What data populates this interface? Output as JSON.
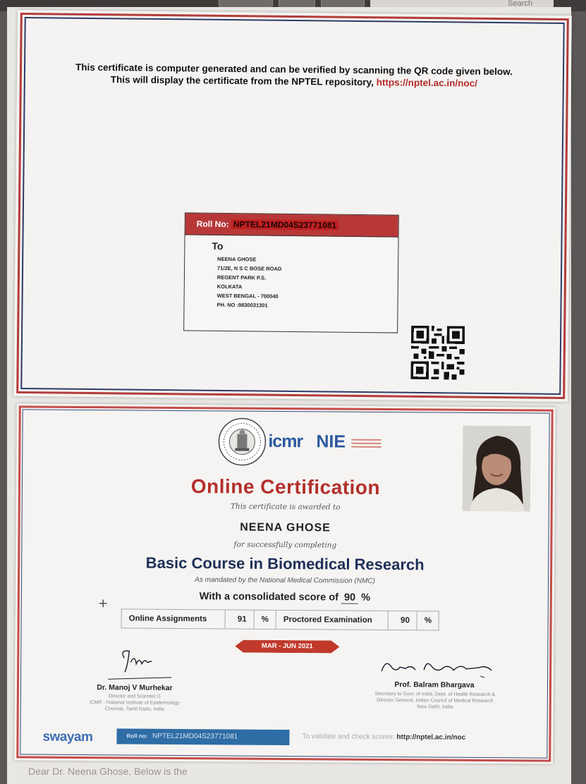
{
  "browser": {
    "search_label": "Search"
  },
  "sheet1": {
    "notice_line1": "This certificate is computer generated and can be verified by scanning the QR code given below.",
    "notice_line2": "This will display the certificate from the NPTEL repository,",
    "notice_url": "https://nptel.ac.in/noc/",
    "roll_label": "Roll No:",
    "roll_value": "NPTEL21MD04S23771081",
    "to_label": "To",
    "address": [
      "NEENA GHOSE",
      "71/2E, N S C BOSE ROAD",
      "REGENT PARK P.S.",
      "KOLKATA",
      "WEST BENGAL - 700040",
      "PH. NO :9830031301"
    ]
  },
  "sheet2": {
    "logo_icmr": "icmr",
    "logo_nie": "NIE",
    "title": "Online Certification",
    "awarded_to": "This certificate is awarded to",
    "recipient": "NEENA GHOSE",
    "completing": "for successfully completing",
    "course": "Basic Course in Biomedical Research",
    "mandate": "As mandated by the National Medical Commission (NMC)",
    "score_prefix": "With a consolidated score of",
    "score_value": "90",
    "score_suffix": "%",
    "table": {
      "online_label": "Online Assignments",
      "online_value": "91",
      "pct1": "%",
      "proctored_label": "Proctored Examination",
      "proctored_value": "90",
      "pct2": "%"
    },
    "period": "MAR - JUN 2021",
    "left_signatory": {
      "name": "Dr. Manoj V Murhekar",
      "role1": "Director and Scientist G",
      "role2": "ICMR - National Institute of Epidemiology",
      "role3": "Chennai, Tamil Nadu, India"
    },
    "right_signatory": {
      "name": "Prof. Balram Bhargava",
      "role1": "Secretary to Govt. of India, Dept. of Health Research &",
      "role2": "Director General, Indian Council of Medical Research",
      "role3": "New Delhi, India"
    },
    "swayam": "swayam",
    "footer_roll_label": "Roll no:",
    "footer_roll_value": "NPTEL21MD04S23771081",
    "verify_text": "To validate and check scores:",
    "verify_url": "http://nptel.ac.in/noc"
  },
  "bottom_text": "Dear Dr. Neena Ghose, Below is the"
}
